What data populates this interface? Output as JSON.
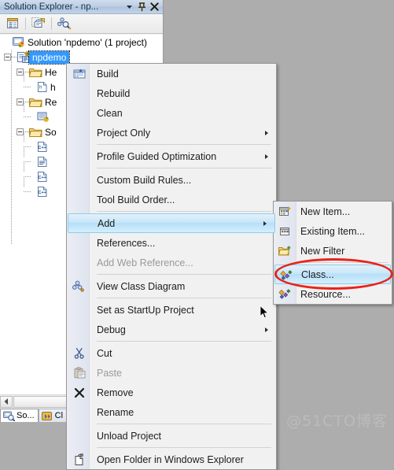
{
  "panel": {
    "title": "Solution Explorer - np...",
    "title_buttons": [
      {
        "name": "window-dropdown-button",
        "glyph": "▼"
      },
      {
        "name": "pin-button",
        "glyph": "auto-hide-pin"
      },
      {
        "name": "close-button",
        "glyph": "✕"
      }
    ],
    "toolbar": [
      {
        "name": "properties-icon",
        "label": "Properties"
      },
      {
        "name": "show-all-files-icon",
        "label": "Show All Files"
      },
      {
        "name": "class-view-search-icon",
        "label": "Class View Search"
      }
    ]
  },
  "tree": {
    "items": [
      {
        "label": "Solution 'npdemo' (1 project)",
        "icon": "solution-icon",
        "depth": 0,
        "expander": false,
        "selected": false
      },
      {
        "label": "npdemo",
        "icon": "cpp-project-icon",
        "depth": 1,
        "expander": true,
        "selected": true
      },
      {
        "label": "He",
        "icon": "folder-icon",
        "depth": 2,
        "expander": true,
        "selected": false
      },
      {
        "label": "h",
        "icon": "header-file-icon",
        "depth": 3,
        "expander": false,
        "selected": false
      },
      {
        "label": "Re",
        "icon": "folder-icon",
        "depth": 2,
        "expander": true,
        "selected": false
      },
      {
        "label": "",
        "icon": "resource-file-icon",
        "depth": 3,
        "expander": false,
        "selected": false
      },
      {
        "label": "So",
        "icon": "folder-icon",
        "depth": 2,
        "expander": true,
        "selected": false
      },
      {
        "label": "",
        "icon": "cpp-file-icon",
        "depth": 3,
        "expander": false,
        "selected": false
      },
      {
        "label": "",
        "icon": "text-file-icon",
        "depth": 3,
        "expander": false,
        "selected": false
      },
      {
        "label": "",
        "icon": "cpp-file-icon",
        "depth": 3,
        "expander": false,
        "selected": false
      },
      {
        "label": "",
        "icon": "cpp-file-icon",
        "depth": 3,
        "expander": false,
        "selected": false
      }
    ]
  },
  "dock_tabs": [
    {
      "label": "So...",
      "icon": "solution-explorer-icon",
      "active": true
    },
    {
      "label": "Cl",
      "icon": "class-view-icon",
      "active": false
    }
  ],
  "context_menu": {
    "items": [
      {
        "label": "Build",
        "icon": "build-icon",
        "type": "item"
      },
      {
        "label": "Rebuild",
        "icon": "",
        "type": "item"
      },
      {
        "label": "Clean",
        "icon": "",
        "type": "item"
      },
      {
        "label": "Project Only",
        "icon": "",
        "type": "submenu"
      },
      {
        "type": "separator"
      },
      {
        "label": "Profile Guided Optimization",
        "icon": "",
        "type": "submenu"
      },
      {
        "type": "separator"
      },
      {
        "label": "Custom Build Rules...",
        "icon": "",
        "type": "item"
      },
      {
        "label": "Tool Build Order...",
        "icon": "",
        "type": "item"
      },
      {
        "type": "separator"
      },
      {
        "label": "Add",
        "icon": "",
        "type": "submenu",
        "highlighted": true
      },
      {
        "label": "References...",
        "icon": "",
        "type": "item"
      },
      {
        "label": "Add Web Reference...",
        "icon": "",
        "type": "item",
        "disabled": true
      },
      {
        "type": "separator"
      },
      {
        "label": "View Class Diagram",
        "icon": "class-diagram-icon",
        "type": "item"
      },
      {
        "type": "separator"
      },
      {
        "label": "Set as StartUp Project",
        "icon": "",
        "type": "item"
      },
      {
        "label": "Debug",
        "icon": "",
        "type": "submenu"
      },
      {
        "type": "separator"
      },
      {
        "label": "Cut",
        "icon": "cut-icon",
        "type": "item"
      },
      {
        "label": "Paste",
        "icon": "paste-icon",
        "type": "item",
        "disabled": true
      },
      {
        "label": "Remove",
        "icon": "remove-icon",
        "type": "item"
      },
      {
        "label": "Rename",
        "icon": "",
        "type": "item"
      },
      {
        "type": "separator"
      },
      {
        "label": "Unload Project",
        "icon": "",
        "type": "item"
      },
      {
        "type": "separator"
      },
      {
        "label": "Open Folder in Windows Explorer",
        "icon": "open-folder-icon",
        "type": "item"
      }
    ]
  },
  "submenu": {
    "items": [
      {
        "label": "New Item...",
        "icon": "new-item-icon",
        "type": "item"
      },
      {
        "label": "Existing Item...",
        "icon": "existing-item-icon",
        "type": "item"
      },
      {
        "label": "New Filter",
        "icon": "new-filter-icon",
        "type": "item"
      },
      {
        "type": "separator"
      },
      {
        "label": "Class...",
        "icon": "class-icon",
        "type": "item",
        "highlighted": true
      },
      {
        "label": "Resource...",
        "icon": "resource-icon",
        "type": "item"
      }
    ]
  },
  "annotation": {
    "shape": "ellipse",
    "color": "#e8231a",
    "target": "Class..."
  },
  "watermark": {
    "text": "@51CTO博客"
  },
  "colors": {
    "selection_blue": "#3399ff",
    "menu_bg": "#f1f1f1",
    "highlight": "#b6dff8",
    "annotation_red": "#e8231a",
    "workspace_gray": "#adadad"
  }
}
